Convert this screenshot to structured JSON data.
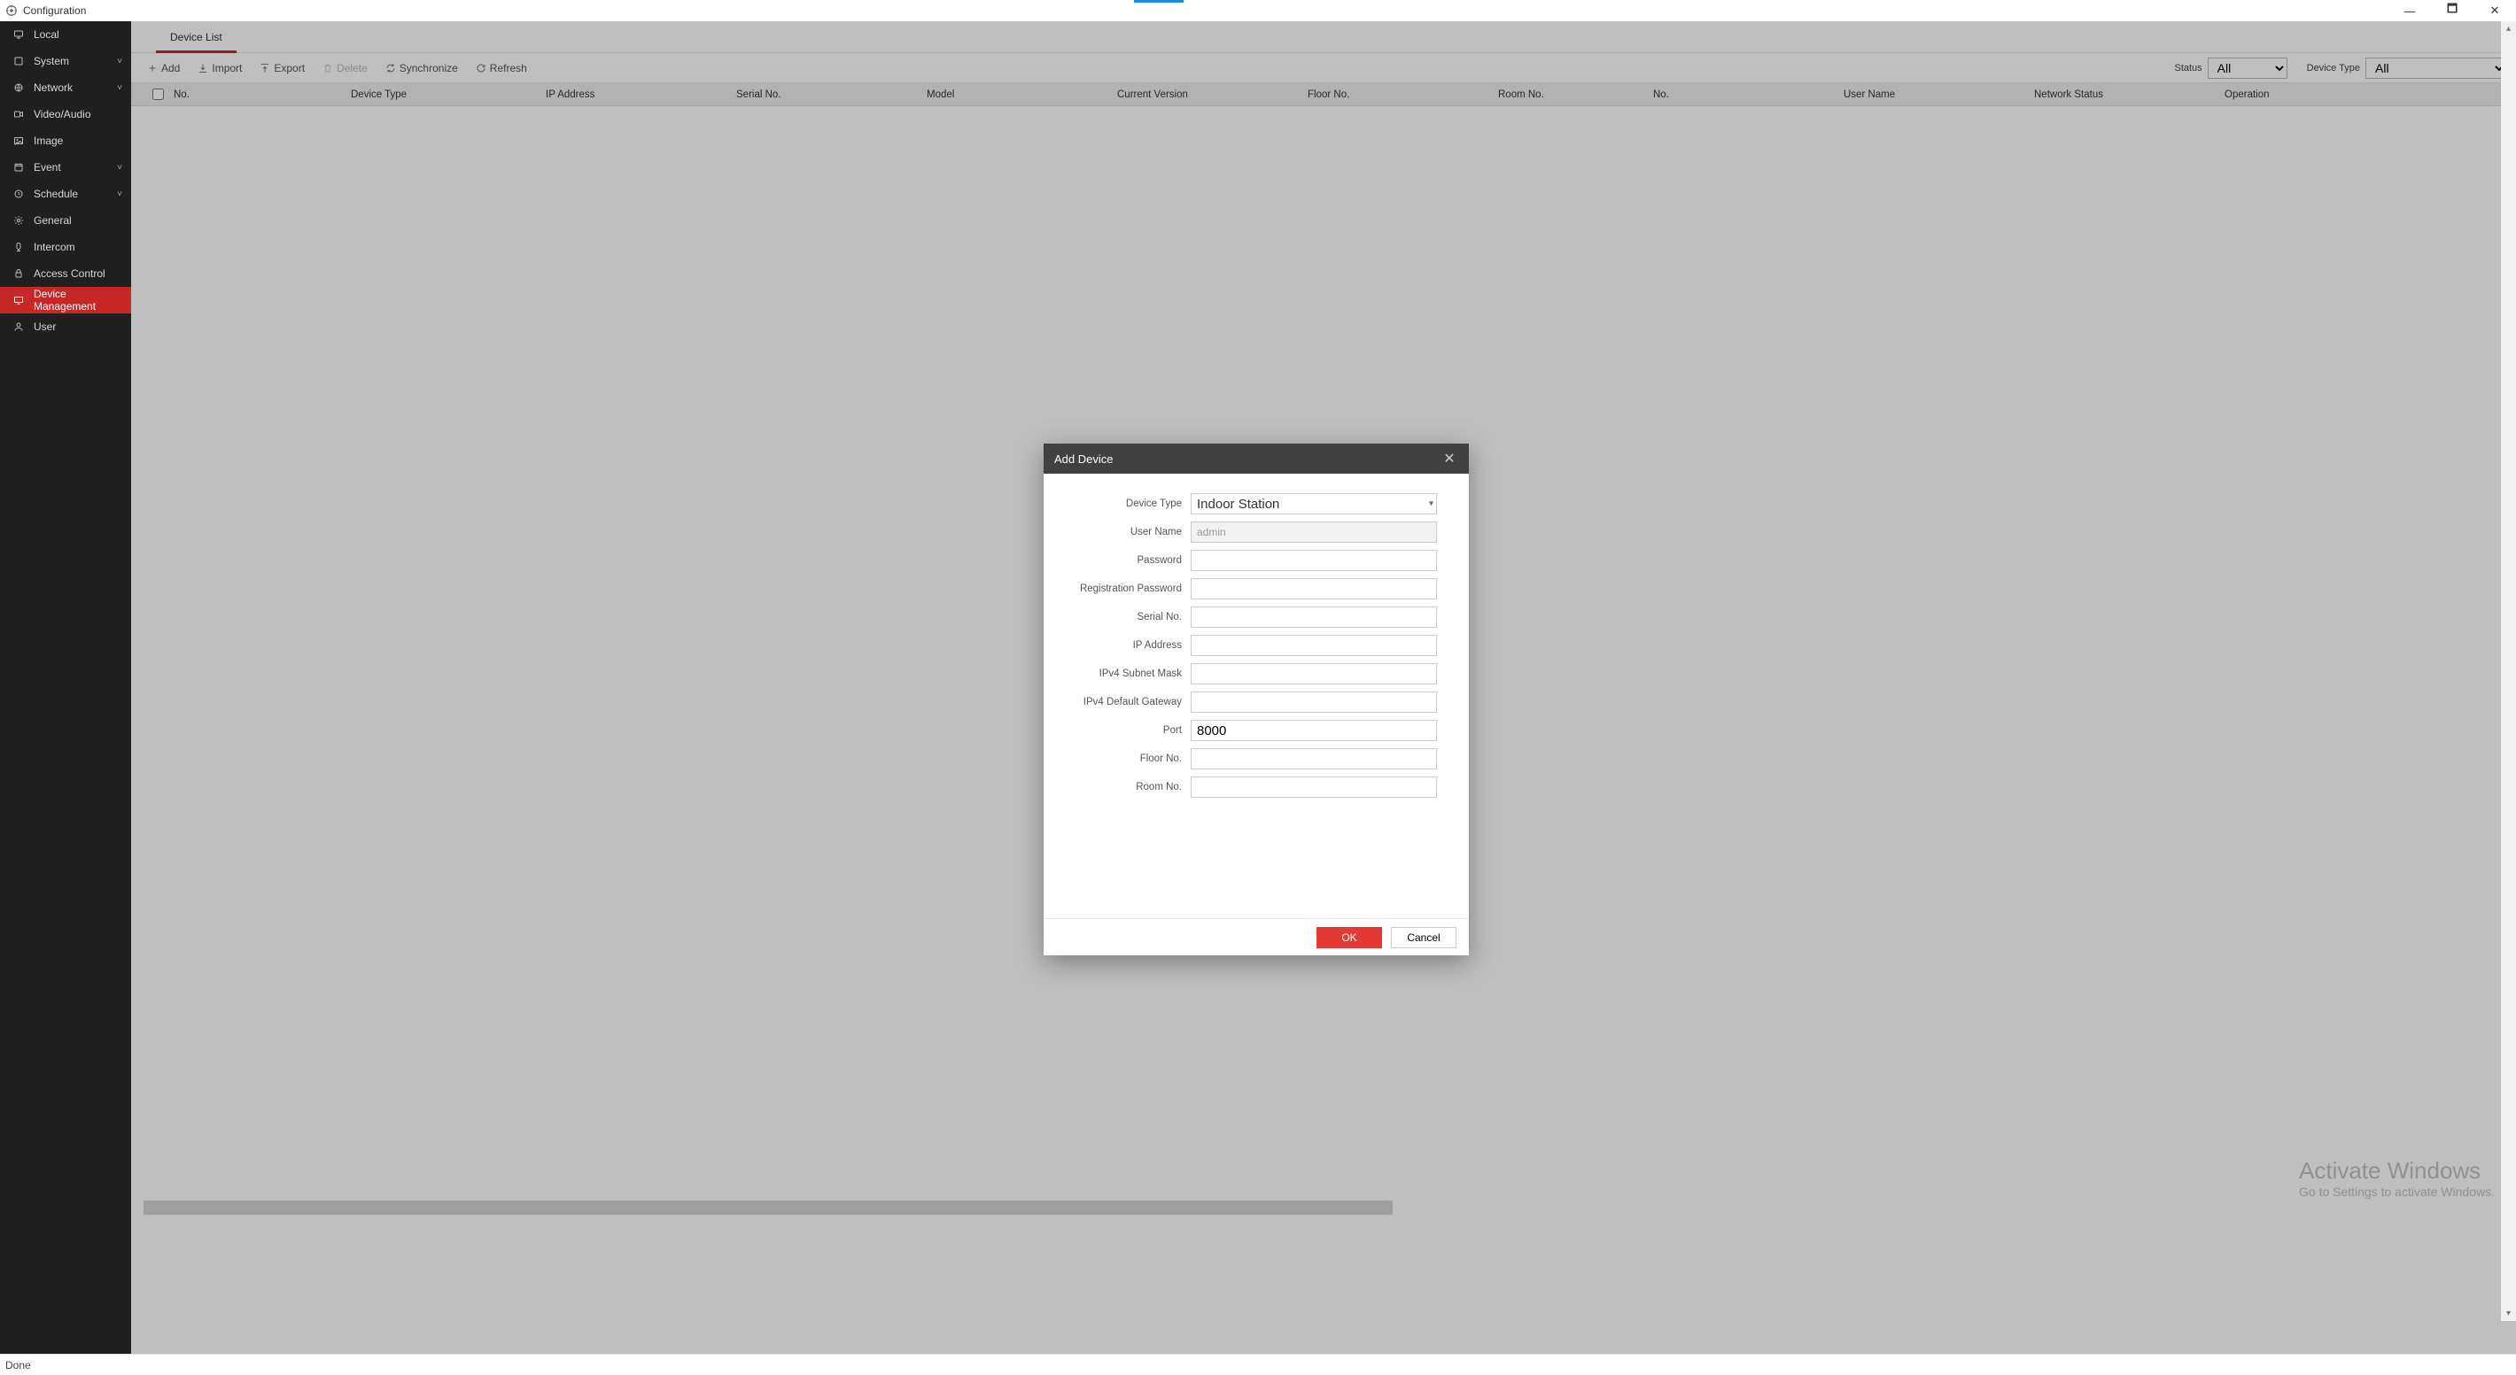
{
  "window": {
    "title": "Configuration"
  },
  "window_controls": {
    "min": "—",
    "max": "🗖",
    "close": "✕"
  },
  "blue_tab_top": true,
  "sidebar": {
    "items": [
      {
        "icon": "monitor-icon",
        "label": "Local",
        "expandable": false,
        "active": false
      },
      {
        "icon": "system-icon",
        "label": "System",
        "expandable": true,
        "active": false
      },
      {
        "icon": "globe-icon",
        "label": "Network",
        "expandable": true,
        "active": false
      },
      {
        "icon": "video-icon",
        "label": "Video/Audio",
        "expandable": false,
        "active": false
      },
      {
        "icon": "image-icon",
        "label": "Image",
        "expandable": false,
        "active": false
      },
      {
        "icon": "event-icon",
        "label": "Event",
        "expandable": true,
        "active": false
      },
      {
        "icon": "schedule-icon",
        "label": "Schedule",
        "expandable": true,
        "active": false
      },
      {
        "icon": "gear-icon",
        "label": "General",
        "expandable": false,
        "active": false
      },
      {
        "icon": "intercom-icon",
        "label": "Intercom",
        "expandable": false,
        "active": false
      },
      {
        "icon": "lock-icon",
        "label": "Access Control",
        "expandable": false,
        "active": false
      },
      {
        "icon": "device-icon",
        "label": "Device Management",
        "expandable": false,
        "active": true
      },
      {
        "icon": "user-icon",
        "label": "User",
        "expandable": false,
        "active": false
      }
    ]
  },
  "tabs": [
    {
      "label": "Device List",
      "active": true
    }
  ],
  "toolbar": {
    "add": "Add",
    "import": "Import",
    "export": "Export",
    "delete": "Delete",
    "synchronize": "Synchronize",
    "refresh": "Refresh",
    "filters": {
      "status_label": "Status",
      "status_value": "All",
      "device_type_label": "Device Type",
      "device_type_value": "All"
    }
  },
  "table": {
    "columns": [
      "No.",
      "Device Type",
      "IP Address",
      "Serial No.",
      "Model",
      "Current Version",
      "Floor No.",
      "Room No.",
      "No.",
      "User Name",
      "Network Status",
      "Operation"
    ]
  },
  "watermark": {
    "line1": "Activate Windows",
    "line2": "Go to Settings to activate Windows."
  },
  "statusbar": {
    "text": "Done"
  },
  "modal": {
    "title": "Add Device",
    "fields": {
      "device_type_label": "Device Type",
      "device_type_value": "Indoor Station",
      "user_name_label": "User Name",
      "user_name_value": "admin",
      "password_label": "Password",
      "password_value": "",
      "reg_password_label": "Registration Password",
      "reg_password_value": "",
      "serial_no_label": "Serial No.",
      "serial_no_value": "",
      "ip_address_label": "IP Address",
      "ip_address_value": "",
      "subnet_mask_label": "IPv4 Subnet Mask",
      "subnet_mask_value": "",
      "gateway_label": "IPv4 Default Gateway",
      "gateway_value": "",
      "port_label": "Port",
      "port_value": "8000",
      "floor_no_label": "Floor No.",
      "floor_no_value": "",
      "room_no_label": "Room No.",
      "room_no_value": ""
    },
    "buttons": {
      "ok": "OK",
      "cancel": "Cancel"
    }
  }
}
